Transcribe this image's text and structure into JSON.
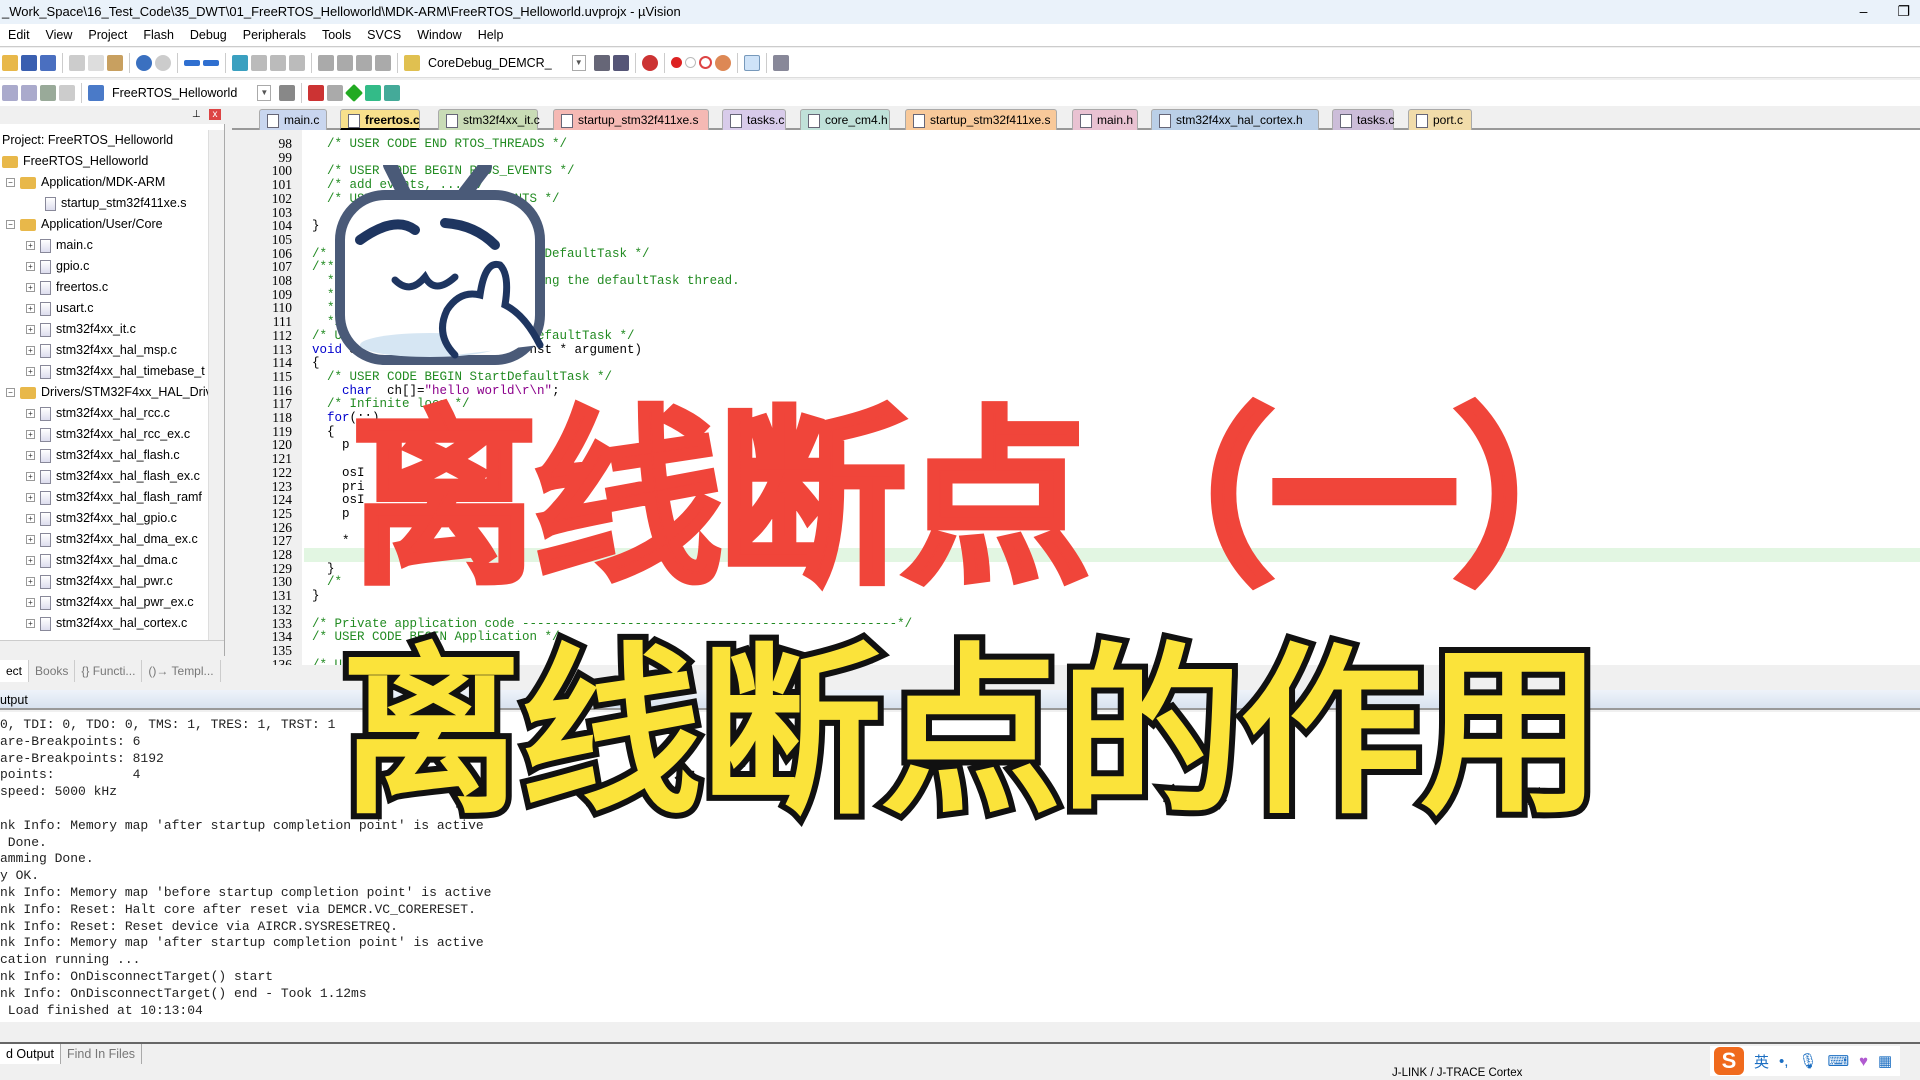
{
  "window": {
    "title": "_Work_Space\\16_Test_Code\\35_DWT\\01_FreeRTOS_Helloworld\\MDK-ARM\\FreeRTOS_Helloworld.uvprojx - µVision",
    "minimize": "–",
    "restore": "❐"
  },
  "menu": [
    "Edit",
    "View",
    "Project",
    "Flash",
    "Debug",
    "Peripherals",
    "Tools",
    "SVCS",
    "Window",
    "Help"
  ],
  "toolbar": {
    "find_combo": "CoreDebug_DEMCR_",
    "target_combo": "FreeRTOS_Helloworld"
  },
  "tabs": [
    {
      "label": "main.c",
      "color": "#c9d6ef",
      "active": false
    },
    {
      "label": "freertos.c",
      "color": "#f8e08c",
      "active": true
    },
    {
      "label": "stm32f4xx_it.c",
      "color": "#c9dcb6",
      "active": false
    },
    {
      "label": "startup_stm32f411xe.s",
      "color": "#f5b9b4",
      "active": false
    },
    {
      "label": "tasks.c",
      "color": "#d8cbea",
      "active": false
    },
    {
      "label": "core_cm4.h",
      "color": "#c0e1d9",
      "active": false
    },
    {
      "label": "startup_stm32f411xe.s",
      "color": "#f8c99a",
      "active": false
    },
    {
      "label": "main.h",
      "color": "#e9c2d2",
      "active": false
    },
    {
      "label": "stm32f4xx_hal_cortex.h",
      "color": "#bacfe7",
      "active": false
    },
    {
      "label": "tasks.c",
      "color": "#ccbdd9",
      "active": false
    },
    {
      "label": "port.c",
      "color": "#f1dcaa",
      "active": false
    }
  ],
  "project": {
    "header": "Project: FreeRTOS_Helloworld",
    "tree": [
      {
        "label": "FreeRTOS_Helloworld",
        "level": 0,
        "type": "root"
      },
      {
        "label": "Application/MDK-ARM",
        "level": 1,
        "type": "folder"
      },
      {
        "label": "startup_stm32f411xe.s",
        "level": 2,
        "type": "file",
        "leaf": true
      },
      {
        "label": "Application/User/Core",
        "level": 1,
        "type": "folder"
      },
      {
        "label": "main.c",
        "level": 2,
        "type": "file"
      },
      {
        "label": "gpio.c",
        "level": 2,
        "type": "file"
      },
      {
        "label": "freertos.c",
        "level": 2,
        "type": "file"
      },
      {
        "label": "usart.c",
        "level": 2,
        "type": "file"
      },
      {
        "label": "stm32f4xx_it.c",
        "level": 2,
        "type": "file"
      },
      {
        "label": "stm32f4xx_hal_msp.c",
        "level": 2,
        "type": "file"
      },
      {
        "label": "stm32f4xx_hal_timebase_t",
        "level": 2,
        "type": "file"
      },
      {
        "label": "Drivers/STM32F4xx_HAL_Driv",
        "level": 1,
        "type": "folder"
      },
      {
        "label": "stm32f4xx_hal_rcc.c",
        "level": 2,
        "type": "file"
      },
      {
        "label": "stm32f4xx_hal_rcc_ex.c",
        "level": 2,
        "type": "file"
      },
      {
        "label": "stm32f4xx_hal_flash.c",
        "level": 2,
        "type": "file"
      },
      {
        "label": "stm32f4xx_hal_flash_ex.c",
        "level": 2,
        "type": "file"
      },
      {
        "label": "stm32f4xx_hal_flash_ramf",
        "level": 2,
        "type": "file"
      },
      {
        "label": "stm32f4xx_hal_gpio.c",
        "level": 2,
        "type": "file"
      },
      {
        "label": "stm32f4xx_hal_dma_ex.c",
        "level": 2,
        "type": "file"
      },
      {
        "label": "stm32f4xx_hal_dma.c",
        "level": 2,
        "type": "file"
      },
      {
        "label": "stm32f4xx_hal_pwr.c",
        "level": 2,
        "type": "file"
      },
      {
        "label": "stm32f4xx_hal_pwr_ex.c",
        "level": 2,
        "type": "file"
      },
      {
        "label": "stm32f4xx_hal_cortex.c",
        "level": 2,
        "type": "file"
      }
    ],
    "tabs": [
      "ect",
      "Books",
      "{} Functi...",
      "()→ Templ..."
    ]
  },
  "editor": {
    "first_line": 98,
    "current_line": 128,
    "lines": [
      [
        [
          "  /* USER CODE END RTOS_THREADS */",
          "cm"
        ]
      ],
      [],
      [
        [
          "  /* USER CODE BEGIN RTOS_EVENTS */",
          "cm"
        ]
      ],
      [
        [
          "  /* add events, ... */",
          "cm"
        ]
      ],
      [
        [
          "  /* USER CODE END RTOS_EVENTS */",
          "cm"
        ]
      ],
      [],
      [
        [
          "}",
          "tx"
        ]
      ],
      [],
      [
        [
          "/* USER CODE BEGIN Header_StartDefaultTask */",
          "cm"
        ]
      ],
      [
        [
          "/**",
          "cm"
        ]
      ],
      [
        [
          "  * @brief  Function implementing the defaultTask thread.",
          "cm"
        ]
      ],
      [
        [
          "  * ",
          "cm"
        ]
      ],
      [
        [
          "  * ",
          "cm"
        ]
      ],
      [
        [
          "  */",
          "cm"
        ]
      ],
      [
        [
          "/* USER CODE END Header_StartDefaultTask */",
          "cm"
        ]
      ],
      [
        [
          "void ",
          "kw"
        ],
        [
          "StartDefaultTask(void const * argument)",
          "tx"
        ]
      ],
      [
        [
          "{",
          "tx"
        ]
      ],
      [
        [
          "  /* USER CODE BEGIN StartDefaultTask */",
          "cm"
        ]
      ],
      [
        [
          "    char",
          "kw"
        ],
        [
          "  ch[]=",
          "tx"
        ],
        [
          "\"hello world\\r\\n\"",
          "str"
        ],
        [
          ";",
          "tx"
        ]
      ],
      [
        [
          "  /* Infinite loop */",
          "cm"
        ]
      ],
      [
        [
          "  for",
          "kw"
        ],
        [
          "(;;)",
          "tx"
        ]
      ],
      [
        [
          "  {",
          "tx"
        ]
      ],
      [
        [
          "    p",
          "tx"
        ]
      ],
      [],
      [
        [
          "    osI",
          "tx"
        ]
      ],
      [
        [
          "    pri",
          "tx"
        ]
      ],
      [
        [
          "    osI",
          "tx"
        ]
      ],
      [
        [
          "    p",
          "tx"
        ]
      ],
      [],
      [
        [
          "    *",
          "tx"
        ]
      ],
      [],
      [
        [
          "  }",
          "tx"
        ]
      ],
      [
        [
          "  /* ",
          "cm"
        ]
      ],
      [
        [
          "}",
          "tx"
        ]
      ],
      [],
      [
        [
          "/* Private application code --------------------------------------------------*/",
          "cm"
        ]
      ],
      [
        [
          "/* USER CODE BEGIN Application */",
          "cm"
        ]
      ],
      [],
      [
        [
          "/* U",
          "cm"
        ]
      ]
    ]
  },
  "output": {
    "header": "utput",
    "lines": [
      "0, TDI: 0, TDO: 0, TMS: 1, TRES: 1, TRST: 1",
      "are-Breakpoints: 6",
      "are-Breakpoints: 8192",
      "points:          4",
      "speed: 5000 kHz",
      "",
      "nk Info: Memory map 'after startup completion point' is active",
      " Done.",
      "amming Done.",
      "y OK.",
      "nk Info: Memory map 'before startup completion point' is active",
      "nk Info: Reset: Halt core after reset via DEMCR.VC_CORERESET.",
      "nk Info: Reset: Reset device via AIRCR.SYSRESETREQ.",
      "nk Info: Memory map 'after startup completion point' is active",
      "cation running ...",
      "nk Info: OnDisconnectTarget() start",
      "nk Info: OnDisconnectTarget() end - Took 1.12ms",
      " Load finished at 10:13:04"
    ]
  },
  "bottom_tabs": [
    "d Output",
    "Find In Files"
  ],
  "status": {
    "debugger": "J-LINK / J-TRACE Cortex"
  },
  "ime": {
    "logo": "S",
    "lang": "英",
    "punct": "•,"
  },
  "overlay": {
    "title": "离线断点（一）",
    "subtitle": "离线断点的作用",
    "title_color": "#f0453a",
    "subtitle_color": "#fbe33a"
  }
}
